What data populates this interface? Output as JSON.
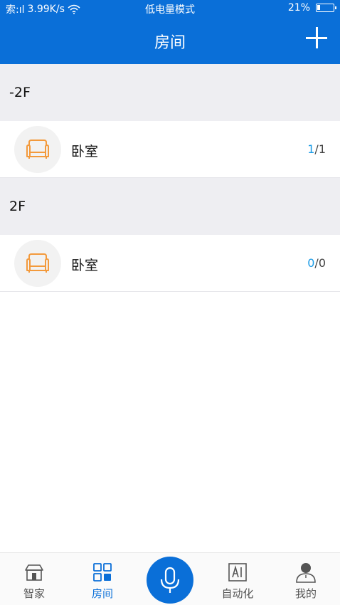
{
  "status_bar": {
    "signal": "索:ıl",
    "speed": "3.99K/s",
    "mode": "低电量模式",
    "battery_percent": "21%",
    "battery_level": 0.21
  },
  "header": {
    "title": "房间",
    "add_icon": "plus-icon"
  },
  "floors": [
    {
      "name": "-2F",
      "rooms": [
        {
          "name": "卧室",
          "active": "1",
          "separator": "/",
          "total": "1",
          "icon": "sofa-icon"
        }
      ]
    },
    {
      "name": "2F",
      "rooms": [
        {
          "name": "卧室",
          "active": "0",
          "separator": "/",
          "total": "0",
          "icon": "sofa-icon"
        }
      ]
    }
  ],
  "tabs": {
    "home": {
      "label": "智家",
      "icon": "house-icon"
    },
    "rooms": {
      "label": "房间",
      "icon": "grid-icon",
      "active": true
    },
    "voice": {
      "icon": "microphone-icon"
    },
    "automation": {
      "label": "自动化",
      "icon": "ai-icon"
    },
    "me": {
      "label": "我的",
      "icon": "person-icon"
    }
  },
  "colors": {
    "primary": "#0a6fd8",
    "accent_orange": "#f39a3c",
    "count_active": "#1a9be6",
    "floor_bg": "#eeeef2"
  }
}
